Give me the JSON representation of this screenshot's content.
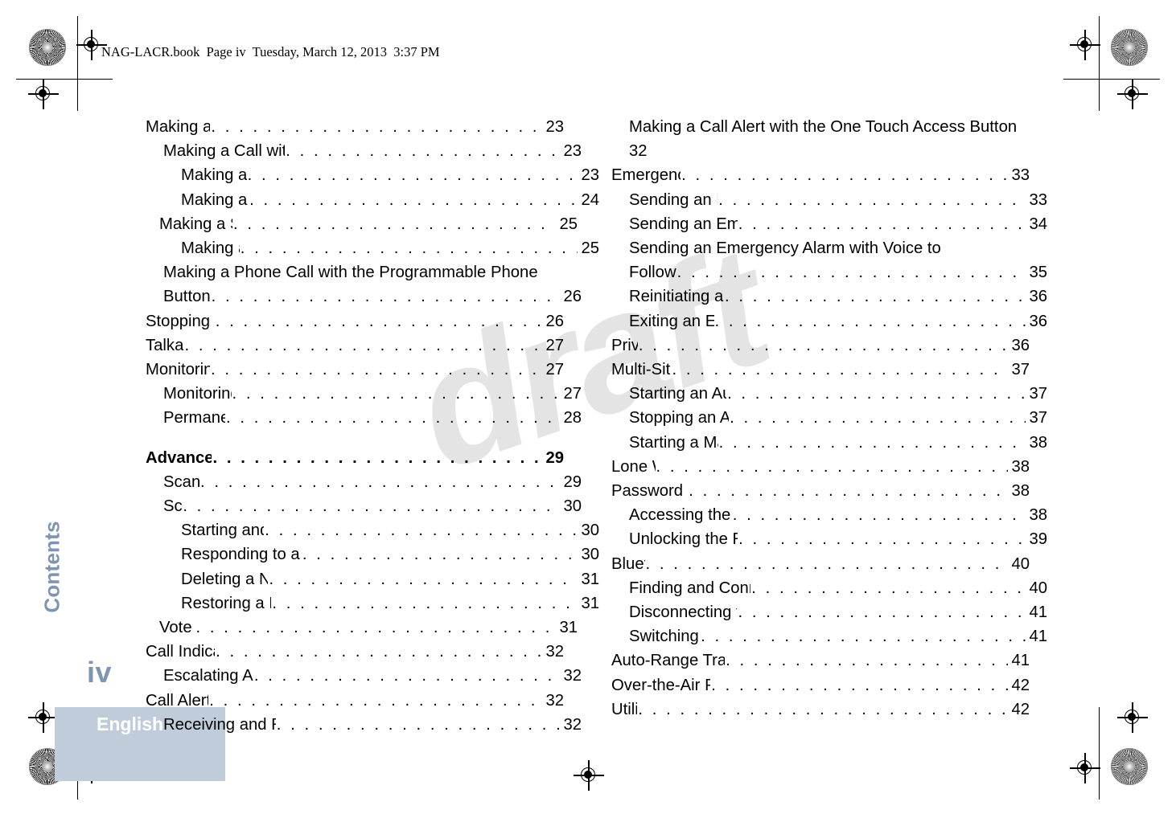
{
  "header": {
    "file_line": "NAG-LACR.book  Page iv  Tuesday, March 12, 2013  3:37 PM"
  },
  "side_tab": {
    "label": "Contents"
  },
  "folio": {
    "page_number": "iv"
  },
  "language_band": {
    "label": "English"
  },
  "watermark": {
    "text": "draft",
    "color": "#e4e4e4"
  },
  "theme": {
    "accent_blue": "#7d95b2",
    "band_blue": "#c0ccd9",
    "text_black": "#000000"
  },
  "toc": {
    "left_column": [
      {
        "title": "Making a Radio Call",
        "page": "23",
        "level": 0,
        "bold": false,
        "wrap": false
      },
      {
        "title": "Making a Call with the Channel Selector Knob",
        "page": "23",
        "level": 1,
        "bold": false,
        "wrap": false
      },
      {
        "title": "Making a Group Call",
        "page": "23",
        "level": 2,
        "bold": false,
        "wrap": false
      },
      {
        "title": "Making a Private Call",
        "page": "24",
        "level": 2,
        "bold": false,
        "wrap": false
      },
      {
        "title": "Making a Selective Call",
        "page": "25",
        "level": 1,
        "bold": false,
        "wrap": false
      },
      {
        "title": "Making an All Call",
        "page": "25",
        "level": 2,
        "bold": false,
        "wrap": false
      },
      {
        "title": "Making a Phone Call with the Programmable Phone",
        "title2": "Button",
        "page": "26",
        "level": 1,
        "bold": false,
        "wrap": true
      },
      {
        "title": "Stopping a Radio Call",
        "page": "26",
        "level": 0,
        "bold": false,
        "wrap": false
      },
      {
        "title": "Talkaround",
        "page": "27",
        "level": 0,
        "bold": false,
        "wrap": false
      },
      {
        "title": "Monitoring Features",
        "page": "27",
        "level": 0,
        "bold": false,
        "wrap": false
      },
      {
        "title": "Monitoring a Channel",
        "page": "27",
        "level": 1,
        "bold": false,
        "wrap": false
      },
      {
        "title": "Permanent Monitor",
        "page": "28",
        "level": 1,
        "bold": false,
        "wrap": false
      },
      {
        "spacer": true
      },
      {
        "title": "Advanced Features",
        "page": "29",
        "level": 0,
        "bold": true,
        "wrap": false
      },
      {
        "title": "Scan Lists",
        "page": "29",
        "level": 1,
        "bold": false,
        "wrap": false
      },
      {
        "title": "Scan",
        "page": "30",
        "level": 1,
        "bold": false,
        "wrap": false
      },
      {
        "title": "Starting and Stopping Scan",
        "page": "30",
        "level": 2,
        "bold": false,
        "wrap": false
      },
      {
        "title": "Responding to a Transmission During a Scan",
        "page": "30",
        "level": 2,
        "bold": false,
        "wrap": false
      },
      {
        "title": "Deleting a Nuisance Channel",
        "page": "31",
        "level": 2,
        "bold": false,
        "wrap": false
      },
      {
        "title": "Restoring a Nuisance Channel",
        "page": "31",
        "level": 2,
        "bold": false,
        "wrap": false
      },
      {
        "title": "Vote Scan",
        "page": "31",
        "level": 1,
        "bold": false,
        "wrap": false
      },
      {
        "title": "Call Indicator Settings",
        "page": "32",
        "level": 0,
        "bold": false,
        "wrap": false
      },
      {
        "title": "Escalating Alarm Tone Volume",
        "page": "32",
        "level": 1,
        "bold": false,
        "wrap": false
      },
      {
        "title": "Call Alert Operation",
        "page": "32",
        "level": 0,
        "bold": false,
        "wrap": false
      },
      {
        "title": "Receiving and Responding to a Call Alert",
        "page": "32",
        "level": 1,
        "bold": false,
        "wrap": false
      }
    ],
    "right_column": [
      {
        "title": "Making a Call Alert with the One Touch Access Button",
        "page": "32",
        "level": 1,
        "bold": false,
        "wrap": true,
        "page_on_own_line": true
      },
      {
        "title": "Emergency Operation",
        "page": "33",
        "level": 0,
        "bold": false,
        "wrap": false
      },
      {
        "title": "Sending an Emergency Alarm",
        "page": "33",
        "level": 1,
        "bold": false,
        "wrap": false
      },
      {
        "title": "Sending an Emergency Alarm with Call",
        "page": "34",
        "level": 1,
        "bold": false,
        "wrap": false
      },
      {
        "title": "Sending an Emergency Alarm with Voice to",
        "title2": "Follow",
        "page": "35",
        "level": 1,
        "bold": false,
        "wrap": true
      },
      {
        "title": "Reinitiating an Emergency Mode",
        "page": "36",
        "level": 1,
        "bold": false,
        "wrap": false
      },
      {
        "title": "Exiting an Emergency Mode",
        "page": "36",
        "level": 1,
        "bold": false,
        "wrap": false
      },
      {
        "title": "Privacy",
        "page": "36",
        "level": 0,
        "bold": false,
        "wrap": false
      },
      {
        "title": "Multi-Site Controls",
        "page": "37",
        "level": 0,
        "bold": false,
        "wrap": false
      },
      {
        "title": "Starting an Automatic Site Search",
        "page": "37",
        "level": 1,
        "bold": false,
        "wrap": false
      },
      {
        "title": "Stopping an Automatic Site Search",
        "page": "37",
        "level": 1,
        "bold": false,
        "wrap": false
      },
      {
        "title": "Starting a Manual Site Search",
        "page": "38",
        "level": 1,
        "bold": false,
        "wrap": false
      },
      {
        "title": "Lone Worker",
        "page": "38",
        "level": 0,
        "bold": false,
        "wrap": false
      },
      {
        "title": "Password Lock Features",
        "page": "38",
        "level": 0,
        "bold": false,
        "wrap": false
      },
      {
        "title": "Accessing the Radio from Password",
        "page": "38",
        "level": 1,
        "bold": false,
        "wrap": false
      },
      {
        "title": "Unlocking the Radio from Locked State",
        "page": "39",
        "level": 1,
        "bold": false,
        "wrap": false
      },
      {
        "title": "Bluetooth",
        "page": "40",
        "level": 0,
        "bold": false,
        "wrap": false
      },
      {
        "title": "Finding and Connecting to a Bluetooth Device",
        "page": "40",
        "level": 1,
        "bold": false,
        "wrap": false
      },
      {
        "title": "Disconnecting from a Bluetooth Device",
        "page": "41",
        "level": 1,
        "bold": false,
        "wrap": false
      },
      {
        "title": "Switching Audio Route",
        "page": "41",
        "level": 1,
        "bold": false,
        "wrap": false
      },
      {
        "title": "Auto-Range Transponder System (ARTS)",
        "page": "41",
        "level": 0,
        "bold": false,
        "wrap": false
      },
      {
        "title": "Over-the-Air Programming (OTAP)",
        "page": "42",
        "level": 0,
        "bold": false,
        "wrap": false
      },
      {
        "title": "Utilities",
        "page": "42",
        "level": 0,
        "bold": false,
        "wrap": false
      }
    ]
  }
}
